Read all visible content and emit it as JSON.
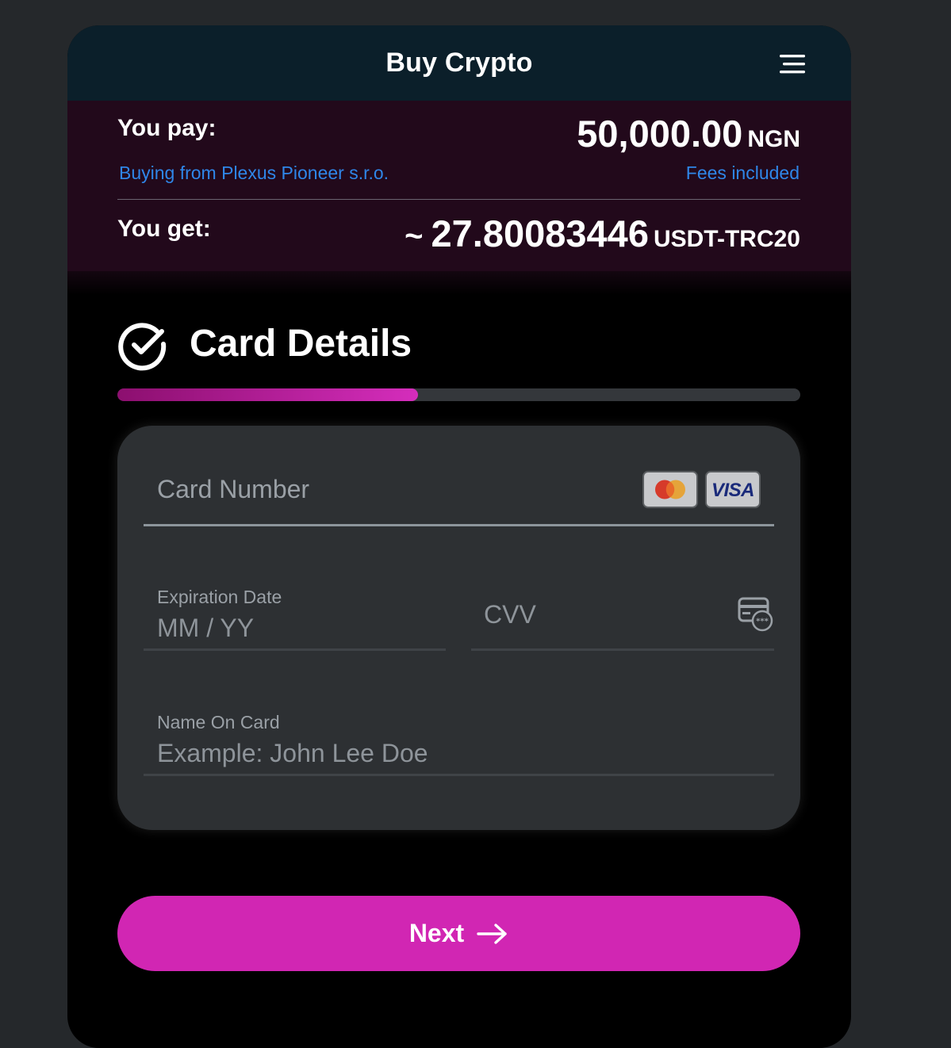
{
  "header": {
    "title": "Buy Crypto",
    "menu_icon": "hamburger-menu-icon"
  },
  "summary": {
    "pay_label": "You pay:",
    "pay_amount": "50,000.00",
    "pay_currency": "NGN",
    "buying_from": "Buying from Plexus Pioneer s.r.o.",
    "fees_note": "Fees included",
    "get_label": "You get:",
    "get_prefix": "~",
    "get_amount": "27.80083446",
    "get_currency": "USDT-TRC20"
  },
  "step": {
    "title": "Card Details",
    "icon": "check-circle-icon",
    "progress_fraction": 0.44
  },
  "form": {
    "card_number_placeholder": "Card Number",
    "card_brands": [
      "mastercard",
      "VISA"
    ],
    "expiration_label": "Expiration Date",
    "expiration_placeholder": "MM / YY",
    "cvv_placeholder": "CVV",
    "name_label": "Name On Card",
    "name_placeholder": "Example: John Lee Doe"
  },
  "actions": {
    "next_label": "Next",
    "next_icon": "arrow-right-icon"
  },
  "colors": {
    "accent": "#d126b3",
    "link": "#2f86e8",
    "header_bg": "#0b1f2a",
    "summary_bg": "#22091b",
    "card_bg": "#2d3033"
  }
}
